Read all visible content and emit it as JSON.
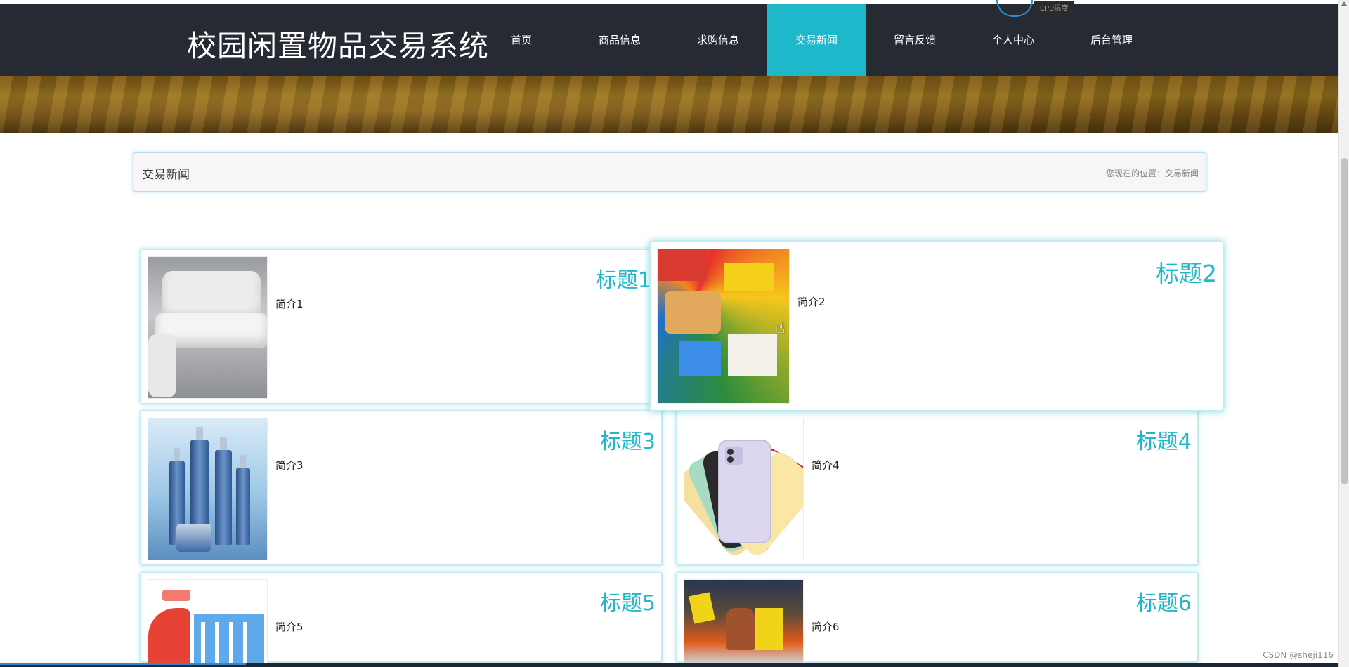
{
  "header": {
    "site_title": "校园闲置物品交易系统",
    "nav": [
      {
        "label": "首页",
        "active": false
      },
      {
        "label": "商品信息",
        "active": false
      },
      {
        "label": "求购信息",
        "active": false
      },
      {
        "label": "交易新闻",
        "active": true
      },
      {
        "label": "留言反馈",
        "active": false
      },
      {
        "label": "个人中心",
        "active": false
      },
      {
        "label": "后台管理",
        "active": false
      }
    ],
    "cpu_widget_label": "CPU温度"
  },
  "breadcrumb": {
    "title": "交易新闻",
    "path": "您现在的位置：交易新闻"
  },
  "news": [
    {
      "title": "标题1",
      "summary": "简介1",
      "image": "sofa"
    },
    {
      "title": "标题2",
      "summary": "简介2",
      "image": "snacks"
    },
    {
      "title": "标题3",
      "summary": "简介3",
      "image": "cosmetics"
    },
    {
      "title": "标题4",
      "summary": "简介4",
      "image": "iphone"
    },
    {
      "title": "标题5",
      "summary": "简介5",
      "image": "shopping-cart"
    },
    {
      "title": "标题6",
      "summary": "简介6",
      "image": "toy-store"
    }
  ],
  "footer": {
    "watermark": "CSDN @sheji116"
  },
  "colors": {
    "accent": "#1fb8cb",
    "nav_bg": "#262a33",
    "panel_border": "#b5dff6"
  }
}
